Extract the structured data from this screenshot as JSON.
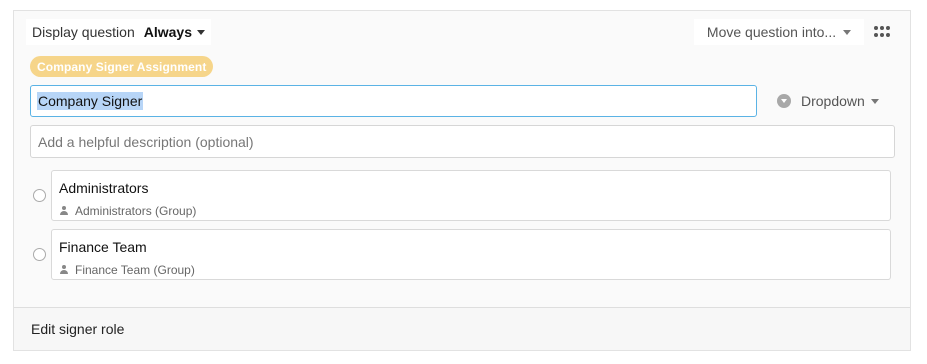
{
  "topbar": {
    "display_label": "Display question",
    "display_value": "Always",
    "move_label": "Move question into...",
    "grip_icon": "drag-grip-icon"
  },
  "badge": {
    "label": "Company Signer Assignment",
    "color": "#f6d58a"
  },
  "question": {
    "title_value": "Company Signer",
    "description_placeholder": "Add a helpful description (optional)",
    "type_label": "Dropdown",
    "type_icon": "dropdown-circle-icon"
  },
  "options": [
    {
      "name": "Administrators",
      "meta": "Administrators (Group)",
      "meta_icon": "person-icon"
    },
    {
      "name": "Finance Team",
      "meta": "Finance Team (Group)",
      "meta_icon": "person-icon"
    }
  ],
  "footer": {
    "link_label": "Edit signer role"
  },
  "colors": {
    "focus_border": "#5bb3e5",
    "selection": "#b7d5f7"
  }
}
